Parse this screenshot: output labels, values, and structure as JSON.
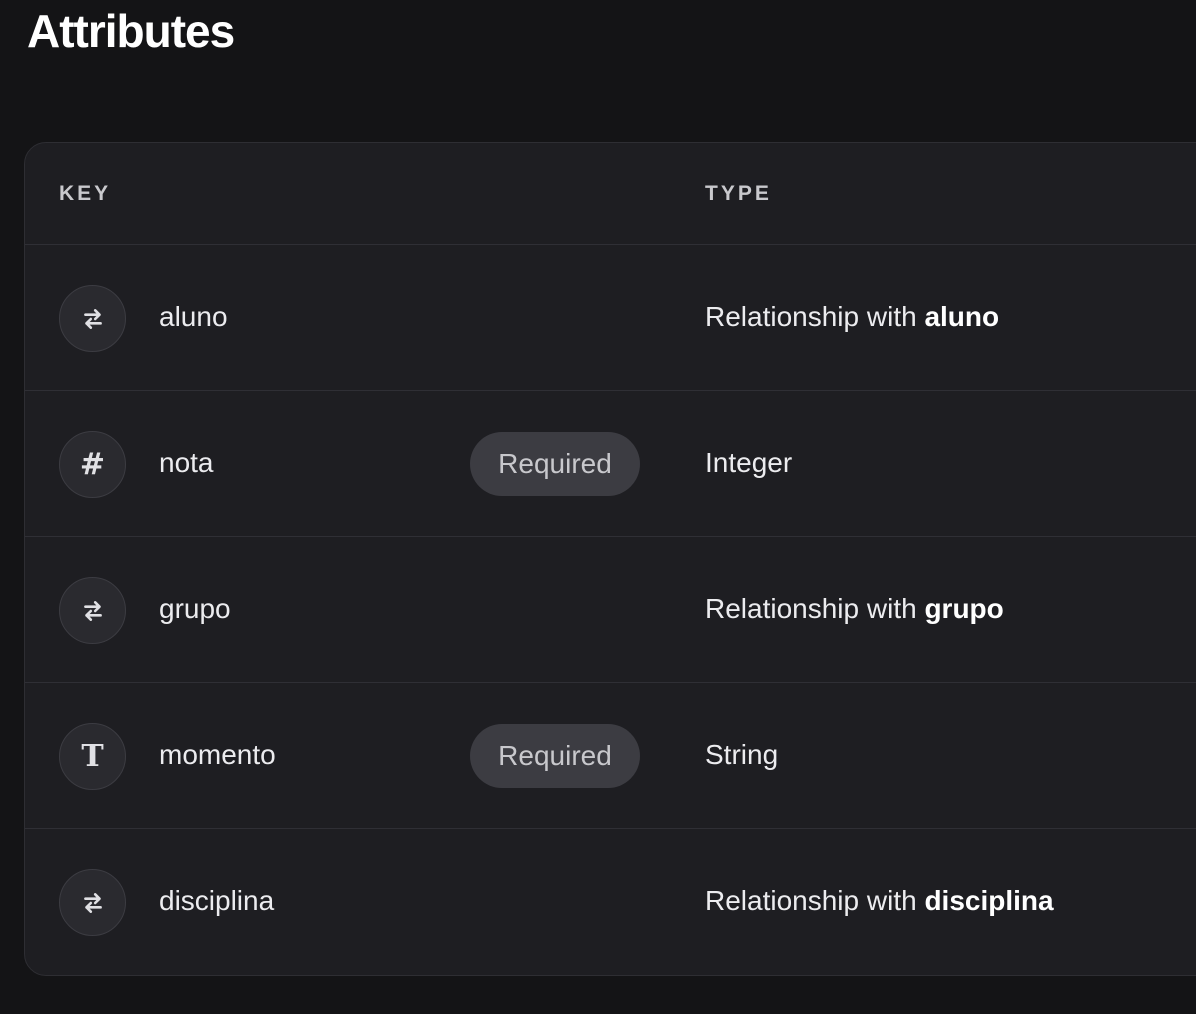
{
  "page": {
    "title": "Attributes"
  },
  "table": {
    "headers": {
      "key": "KEY",
      "type": "TYPE"
    },
    "rows": [
      {
        "icon": "relationship-arrows-icon",
        "key": "aluno",
        "badge": "",
        "type_prefix": "Relationship with ",
        "type_bold": "aluno",
        "type": ""
      },
      {
        "icon": "hash-icon",
        "key": "nota",
        "badge": "Required",
        "type_prefix": "",
        "type_bold": "",
        "type": "Integer"
      },
      {
        "icon": "relationship-arrows-icon",
        "key": "grupo",
        "badge": "",
        "type_prefix": "Relationship with ",
        "type_bold": "grupo",
        "type": ""
      },
      {
        "icon": "text-t-icon",
        "key": "momento",
        "badge": "Required",
        "type_prefix": "",
        "type_bold": "",
        "type": "String"
      },
      {
        "icon": "relationship-arrows-icon",
        "key": "disciplina",
        "badge": "",
        "type_prefix": "Relationship with ",
        "type_bold": "disciplina",
        "type": ""
      }
    ]
  },
  "colors": {
    "background": "#141416",
    "card": "#1e1e22",
    "badge": "#3c3c42"
  }
}
